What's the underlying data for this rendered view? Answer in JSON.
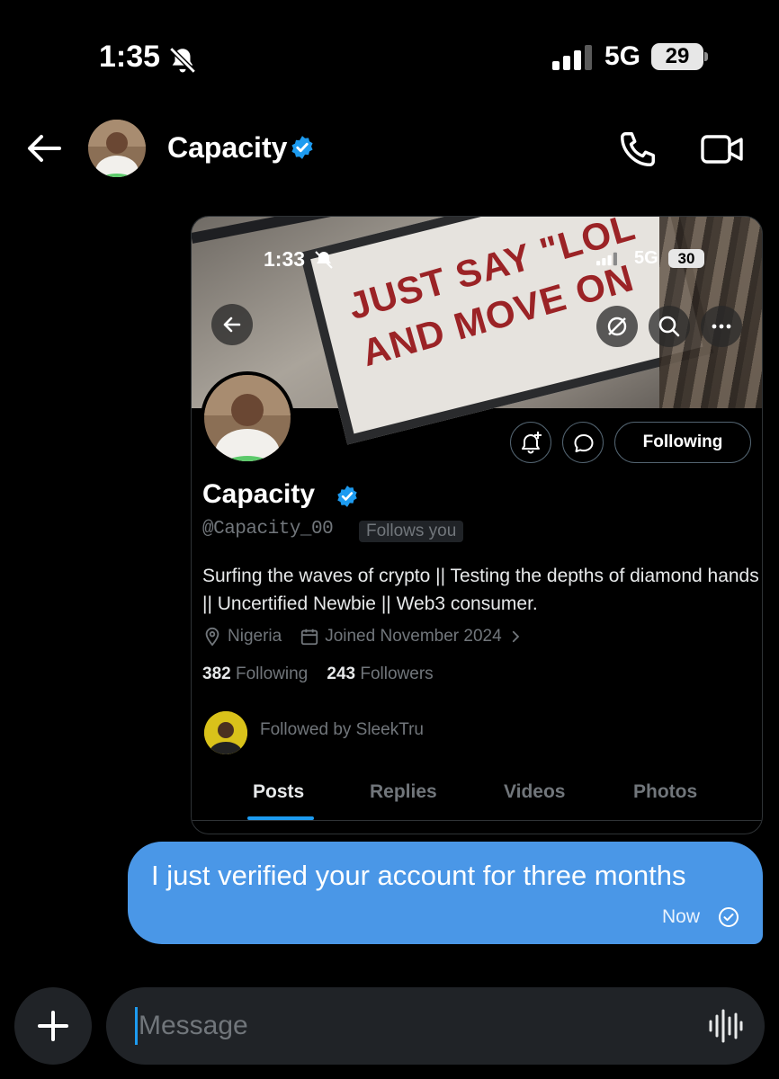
{
  "status_bar": {
    "time": "1:35",
    "network": "5G",
    "battery": "29"
  },
  "header": {
    "name": "Capacity"
  },
  "shared_card": {
    "banner_text": "JUST SAY \"LOL\nAND MOVE ON",
    "status_bar": {
      "time": "1:33",
      "network": "5G",
      "battery": "30"
    },
    "follow_button": "Following",
    "name": "Capacity",
    "handle": "@Capacity_00",
    "follows_you": "Follows you",
    "bio": "Surfing the waves of crypto || Testing the depths of diamond hands || Uncertified Newbie || Web3 consumer.",
    "location": "Nigeria",
    "joined": "Joined November 2024",
    "following_count": "382",
    "following_label": "Following",
    "followers_count": "243",
    "followers_label": "Followers",
    "followed_by": "Followed by SleekTru",
    "tabs": [
      "Posts",
      "Replies",
      "Videos",
      "Photos"
    ],
    "active_tab": "Posts"
  },
  "message": {
    "text": "I just verified your account for three months",
    "time": "Now"
  },
  "composer": {
    "placeholder": "Message"
  },
  "colors": {
    "background": "#000000",
    "bubble": "#4a97e7",
    "accent": "#1d9bf0",
    "verified_badge": "#1d9bf0",
    "muted_text": "#71767b"
  },
  "icons": [
    "bell-slash-icon",
    "signal-icon",
    "battery-icon",
    "back-arrow-icon",
    "verified-badge-icon",
    "phone-icon",
    "video-call-icon",
    "grok-icon",
    "search-icon",
    "more-icon",
    "bell-plus-icon",
    "message-icon",
    "location-icon",
    "calendar-icon",
    "chevron-right-icon",
    "check-circle-icon",
    "plus-icon",
    "voice-icon"
  ]
}
